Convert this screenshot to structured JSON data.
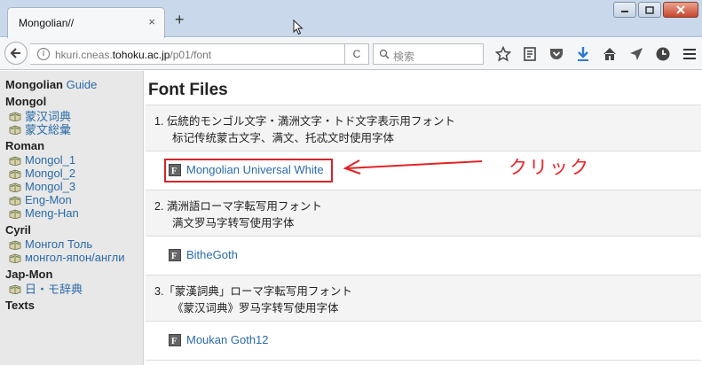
{
  "browser": {
    "tab_title": "Mongolian//",
    "tab_close": "×",
    "new_tab": "+",
    "url_host_prefix": "hkuri.cneas.",
    "url_host_bold": "tohoku.ac.jp",
    "url_path": "/p01/font",
    "search_placeholder": "検索",
    "reload_glyph": "C"
  },
  "sidebar": {
    "title": "Mongolian",
    "guide_link": "Guide",
    "sections": [
      {
        "heading": "Mongol",
        "items": [
          "蒙汉词典",
          "蒙文総彙"
        ]
      },
      {
        "heading": "Roman",
        "items": [
          "Mongol_1",
          "Mongol_2",
          "Mongol_3",
          "Eng-Mon",
          "Meng-Han"
        ]
      },
      {
        "heading": "Cyril",
        "items": [
          "Монгол Толь",
          "монгол-япон/англи"
        ]
      },
      {
        "heading": "Jap-Mon",
        "items": [
          "日・モ辞典"
        ]
      },
      {
        "heading": "Texts",
        "items": []
      }
    ]
  },
  "main": {
    "title": "Font Files",
    "rows": [
      {
        "line1": "1. 伝統的モンゴル文字・満洲文字・トド文字表示用フォント",
        "line2": "标记传统蒙古文字、满文、托忒文时使用字体",
        "link": "Mongolian Universal White"
      },
      {
        "line1": "2. 満洲語ローマ字転写用フォント",
        "line2": "满文罗马字转写使用字体",
        "link": "BitheGoth"
      },
      {
        "line1": "3.「蒙漢詞典」ローマ字転写用フォント",
        "line2": "《蒙汉词典》罗马字转写使用字体",
        "link": "Moukan Goth12"
      }
    ]
  },
  "annotation": {
    "callout": "クリック",
    "color": "#d1262a"
  },
  "colors": {
    "link": "#2a6aa8",
    "sidebar_bg": "#e8e8e8",
    "row_bg": "#f4f4f4"
  }
}
